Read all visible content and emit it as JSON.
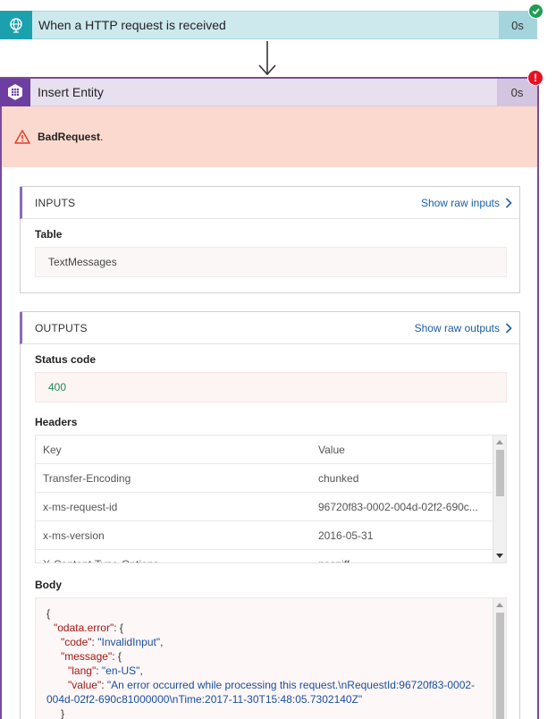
{
  "trigger": {
    "title": "When a HTTP request is received",
    "duration": "0s",
    "status_icon": "check-icon",
    "accent": "#1ba1ae"
  },
  "action": {
    "title": "Insert Entity",
    "duration": "0s",
    "status_icon": "error-icon",
    "error_badge": "!",
    "accent": "#6c3ea0",
    "error_message": "BadRequest",
    "error_suffix": "."
  },
  "inputs": {
    "section_title": "INPUTS",
    "raw_link": "Show raw inputs",
    "table_label": "Table",
    "table_value": "TextMessages"
  },
  "outputs": {
    "section_title": "OUTPUTS",
    "raw_link": "Show raw outputs",
    "status_label": "Status code",
    "status_value": "400",
    "headers_label": "Headers",
    "headers_columns": [
      "Key",
      "Value"
    ],
    "headers_rows": [
      {
        "key": "Transfer-Encoding",
        "value": "chunked"
      },
      {
        "key": "x-ms-request-id",
        "value": "96720f83-0002-004d-02f2-690c..."
      },
      {
        "key": "x-ms-version",
        "value": "2016-05-31"
      },
      {
        "key": "X-Content-Type-Options",
        "value": "nosniff"
      }
    ],
    "body_label": "Body",
    "body_lines": [
      {
        "text": "{"
      },
      {
        "key": "\"odata.error\"",
        "rest": ": {"
      },
      {
        "key": "\"code\"",
        "rest": ": ",
        "val": "\"InvalidInput\"",
        "tail": ","
      },
      {
        "key": "\"message\"",
        "rest": ": {"
      },
      {
        "key": "\"lang\"",
        "rest": ": ",
        "val": "\"en-US\"",
        "tail": ","
      },
      {
        "key": "\"value\"",
        "rest": ": ",
        "val": "\"An error occurred while processing this request.\\nRequestId:96720f83-0002-"
      },
      {
        "val": "004d-02f2-690c81000000\\nTime:2017-11-30T15:48:05.7302140Z\""
      },
      {
        "text": "}"
      }
    ]
  }
}
